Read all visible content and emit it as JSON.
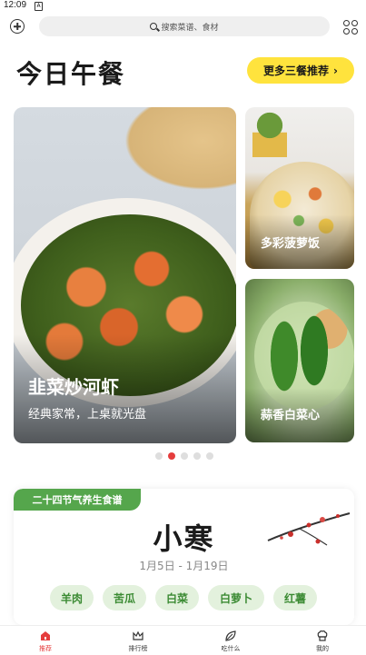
{
  "status": {
    "time": "12:09",
    "notification_glyph": "A"
  },
  "search": {
    "placeholder": "搜索菜谱、食材"
  },
  "header": {
    "title": "今日午餐",
    "more_label": "更多三餐推荐"
  },
  "cards": {
    "featured": {
      "name": "韭菜炒河虾",
      "desc": "经典家常，上桌就光盘"
    },
    "side1": {
      "name": "多彩菠萝饭"
    },
    "side2": {
      "name": "蒜香白菜心"
    }
  },
  "carousel": {
    "count": 5,
    "active_index": 1
  },
  "solar_term": {
    "tag": "二十四节气养生食谱",
    "name": "小寒",
    "range": "1月5日 - 1月19日",
    "foods": [
      "羊肉",
      "苦瓜",
      "白菜",
      "白萝卜",
      "红薯"
    ]
  },
  "nav": {
    "items": [
      {
        "label": "推荐",
        "icon": "home-icon"
      },
      {
        "label": "排行榜",
        "icon": "crown-icon"
      },
      {
        "label": "吃什么",
        "icon": "leaf-icon"
      },
      {
        "label": "我的",
        "icon": "chef-hat-icon"
      }
    ],
    "active_index": 0
  },
  "colors": {
    "accent": "#ffe33d",
    "active": "#e53d3d",
    "green": "#55a64c",
    "chip_bg": "#e3f1dd"
  }
}
